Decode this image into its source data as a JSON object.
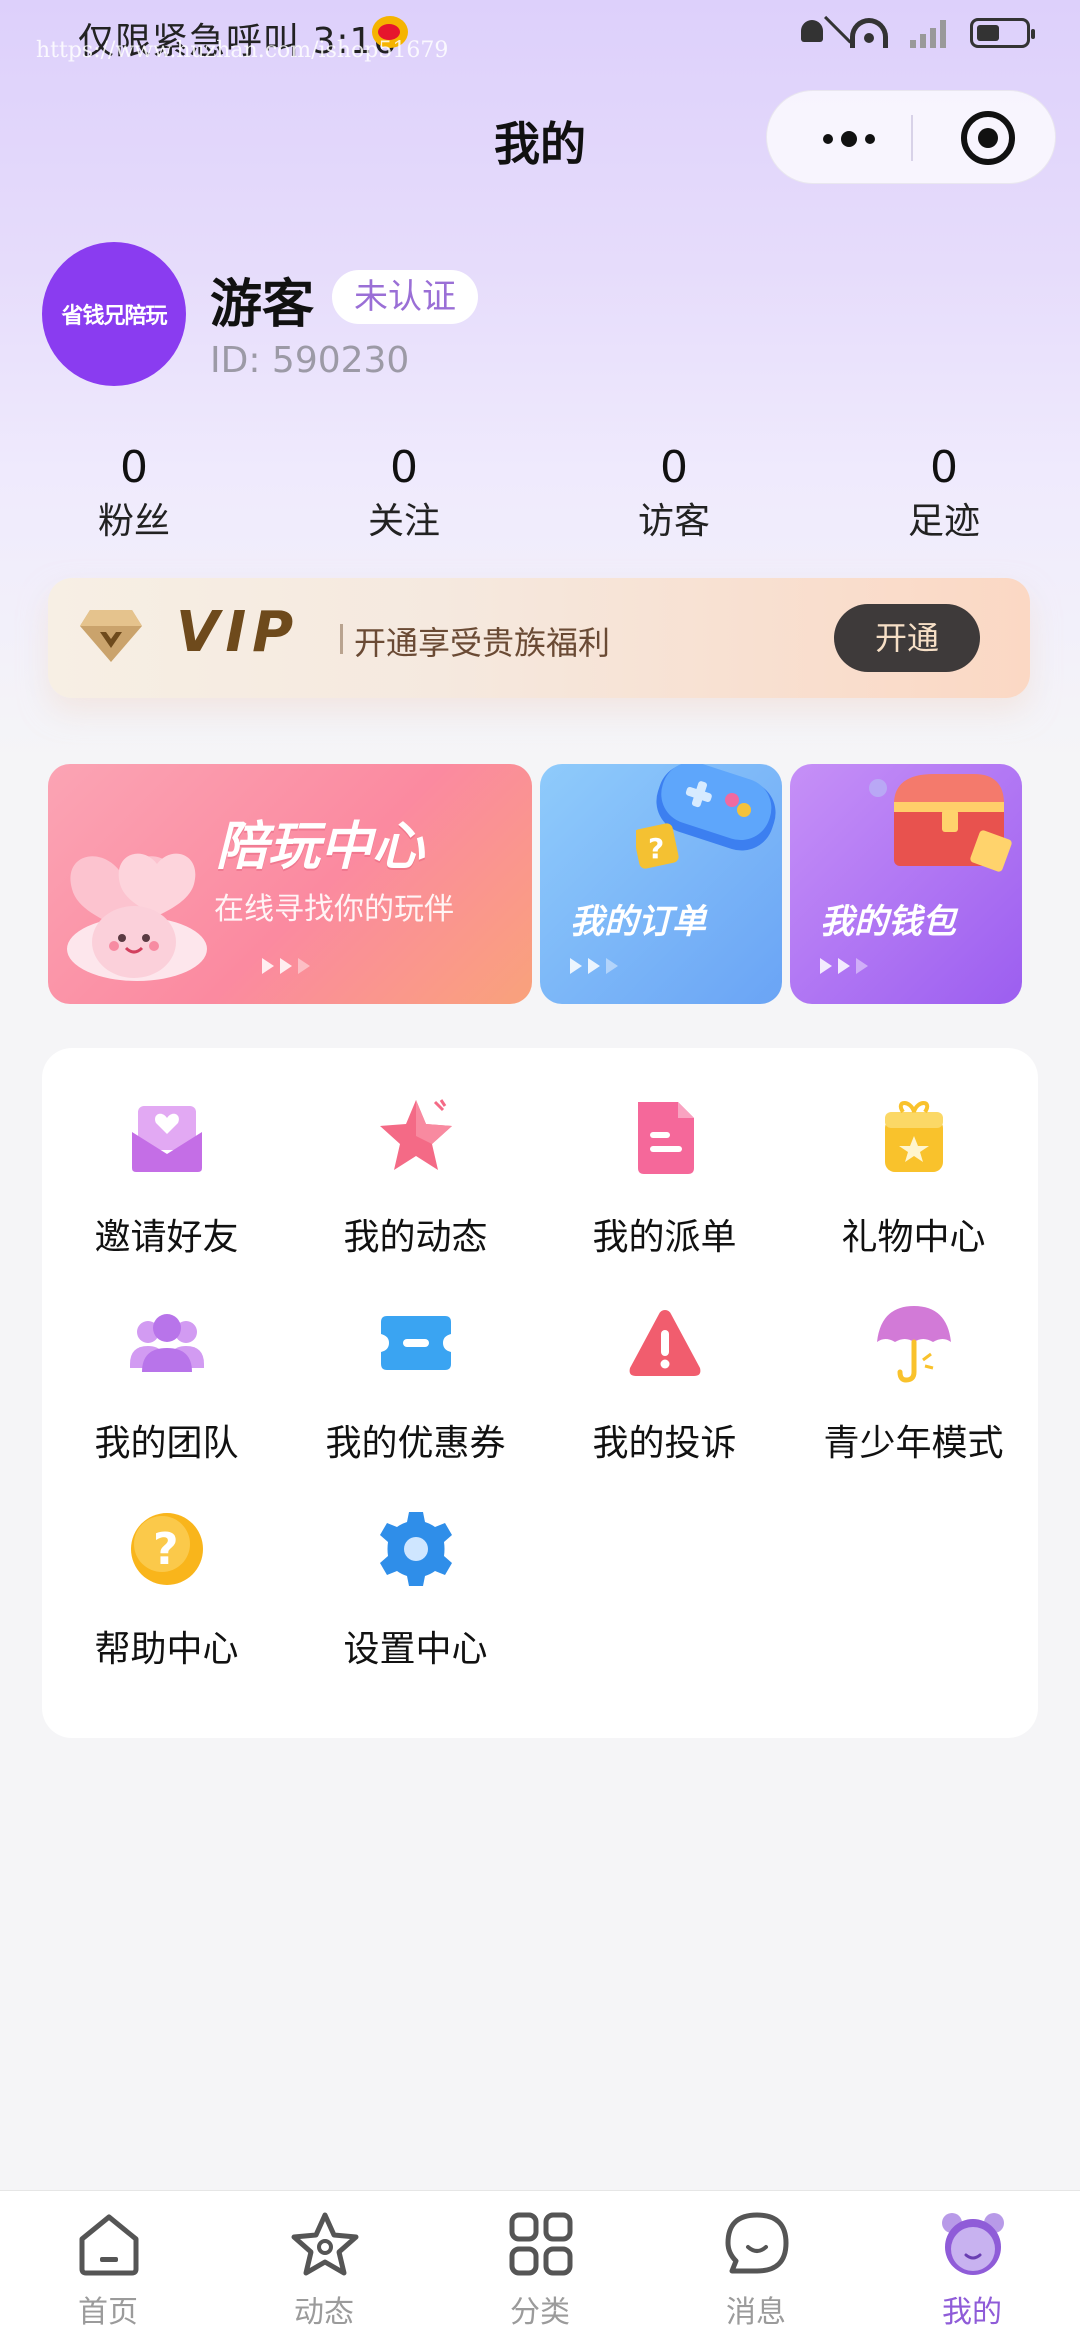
{
  "status_bar": {
    "carrier_time": "仅限紧急呼叫 3:16",
    "watermark": "https://www.huzhan.com/ishop51679"
  },
  "header": {
    "title": "我的"
  },
  "profile": {
    "avatar_text": "省钱兄陪玩",
    "name": "游客",
    "verify_badge": "未认证",
    "id_text": "ID:  590230"
  },
  "stats": [
    {
      "value": "0",
      "label": "粉丝"
    },
    {
      "value": "0",
      "label": "关注"
    },
    {
      "value": "0",
      "label": "访客"
    },
    {
      "value": "0",
      "label": "足迹"
    }
  ],
  "vip": {
    "word": "VIP",
    "text": "开通享受贵族福利",
    "button": "开通"
  },
  "banners": {
    "companion_title": "陪玩中心",
    "companion_sub": "在线寻找你的玩伴",
    "orders_title": "我的订单",
    "wallet_title": "我的钱包"
  },
  "menu": [
    {
      "label": "邀请好友",
      "icon": "invite-envelope-icon",
      "color": "#c46ee6"
    },
    {
      "label": "我的动态",
      "icon": "star-icon",
      "color": "#f46a86"
    },
    {
      "label": "我的派单",
      "icon": "document-icon",
      "color": "#f5689a"
    },
    {
      "label": "礼物中心",
      "icon": "gift-icon",
      "color": "#f9c22c"
    },
    {
      "label": "我的团队",
      "icon": "team-icon",
      "color": "#b874ea"
    },
    {
      "label": "我的优惠券",
      "icon": "coupon-icon",
      "color": "#3aa4f2"
    },
    {
      "label": "我的投诉",
      "icon": "warning-icon",
      "color": "#f15d6e"
    },
    {
      "label": "青少年模式",
      "icon": "umbrella-icon",
      "color": "#d27ad7"
    },
    {
      "label": "帮助中心",
      "icon": "help-icon",
      "color": "#f9b51b"
    },
    {
      "label": "设置中心",
      "icon": "gear-icon",
      "color": "#2f8ee9"
    }
  ],
  "tabbar": [
    {
      "label": "首页",
      "icon": "home-icon"
    },
    {
      "label": "动态",
      "icon": "star-outline-icon"
    },
    {
      "label": "分类",
      "icon": "grid-icon"
    },
    {
      "label": "消息",
      "icon": "chat-icon"
    },
    {
      "label": "我的",
      "icon": "bear-icon",
      "active": true
    }
  ],
  "colors": {
    "accent": "#8f5cd8",
    "avatar": "#8a3cf0",
    "header_gradient_top": "#ddd0fb"
  }
}
